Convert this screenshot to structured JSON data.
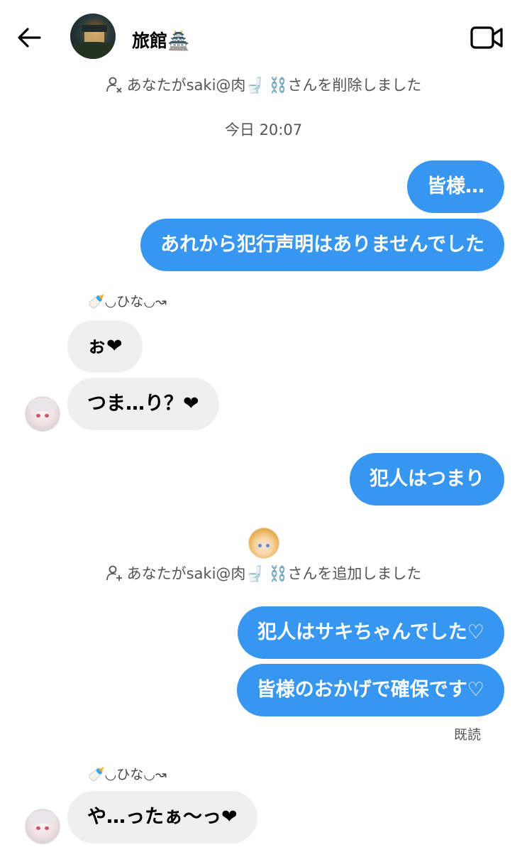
{
  "header": {
    "title": "旅館🏯",
    "back_icon": "arrow-left-icon",
    "video_icon": "video-call-icon"
  },
  "notices": {
    "removed": "あなたがsaki@肉🚽 ⛓️さんを削除しました",
    "added": "あなたがsaki@肉🚽 ⛓️さんを追加しました"
  },
  "timestamp": "今日 20:07",
  "messages": {
    "m1": "皆様…",
    "m2": "あれから犯行声明はありませんでした",
    "m3": "ぉ❤",
    "m4": "つま…り？❤",
    "m5": "犯人はつまり",
    "m6": "犯人はサキちゃんでした♡",
    "m7": "皆様のおかげで確保です♡",
    "m8": "や…ったぁ～っ❤"
  },
  "sender_name": "🍼◡ひな◡↝",
  "seen_label": "既読",
  "colors": {
    "outgoing_bubble": "#3797f0",
    "incoming_bubble": "#efefef"
  }
}
